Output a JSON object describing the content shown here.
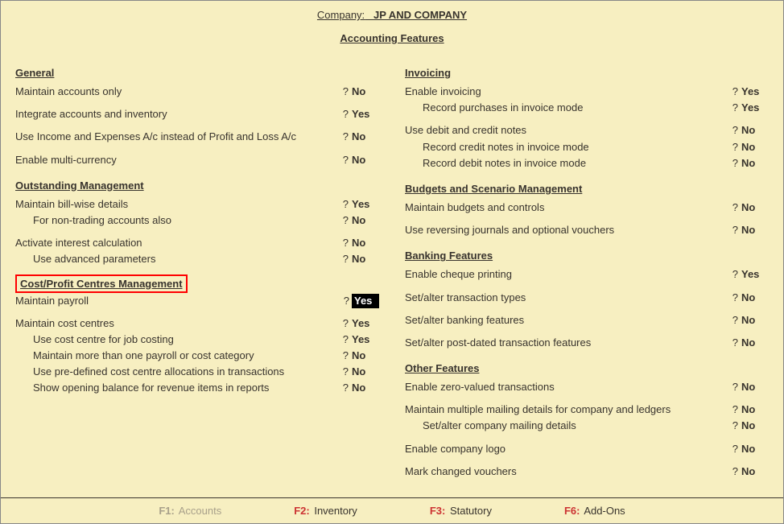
{
  "header": {
    "company_label": "Company:",
    "company_name": "JP AND COMPANY",
    "subtitle": "Accounting Features"
  },
  "left": {
    "general": {
      "title": "General",
      "r1": {
        "label": "Maintain accounts only",
        "value": "No"
      },
      "r2": {
        "label": "Integrate accounts and inventory",
        "value": "Yes"
      },
      "r3": {
        "label": "Use Income and Expenses A/c instead of Profit and Loss A/c",
        "value": "No"
      },
      "r4": {
        "label": "Enable multi-currency",
        "value": "No"
      }
    },
    "outstanding": {
      "title": "Outstanding Management",
      "r1": {
        "label": "Maintain bill-wise details",
        "value": "Yes"
      },
      "r1a": {
        "label": "For non-trading accounts also",
        "value": "No"
      },
      "r2": {
        "label": "Activate interest calculation",
        "value": "No"
      },
      "r2a": {
        "label": "Use advanced parameters",
        "value": "No"
      }
    },
    "cost": {
      "title": "Cost/Profit Centres Management",
      "r1": {
        "label": "Maintain payroll",
        "value": "Yes"
      },
      "r2": {
        "label": "Maintain cost centres",
        "value": "Yes"
      },
      "r2a": {
        "label": "Use cost centre for job costing",
        "value": "Yes"
      },
      "r2b": {
        "label": "Maintain more than one payroll or cost category",
        "value": "No"
      },
      "r2c": {
        "label": "Use pre-defined cost centre allocations in transactions",
        "value": "No"
      },
      "r2d": {
        "label": "Show opening balance for revenue items in reports",
        "value": "No"
      }
    }
  },
  "right": {
    "invoicing": {
      "title": "Invoicing",
      "r1": {
        "label": "Enable invoicing",
        "value": "Yes"
      },
      "r1a": {
        "label": "Record purchases in invoice mode",
        "value": "Yes"
      },
      "r2": {
        "label": "Use debit and credit notes",
        "value": "No"
      },
      "r2a": {
        "label": "Record credit notes in invoice mode",
        "value": "No"
      },
      "r2b": {
        "label": "Record debit notes in invoice mode",
        "value": "No"
      }
    },
    "budgets": {
      "title": "Budgets and Scenario Management",
      "r1": {
        "label": "Maintain budgets and controls",
        "value": "No"
      },
      "r2": {
        "label": "Use reversing journals and optional vouchers",
        "value": "No"
      }
    },
    "banking": {
      "title": "Banking Features",
      "r1": {
        "label": "Enable cheque printing",
        "value": "Yes"
      },
      "r2": {
        "label": "Set/alter transaction types",
        "value": "No"
      },
      "r3": {
        "label": "Set/alter banking features",
        "value": "No"
      },
      "r4": {
        "label": "Set/alter post-dated transaction features",
        "value": "No"
      }
    },
    "other": {
      "title": "Other Features",
      "r1": {
        "label": "Enable zero-valued transactions",
        "value": "No"
      },
      "r2": {
        "label": "Maintain multiple mailing details for company and ledgers",
        "value": "No"
      },
      "r2a": {
        "label": "Set/alter company mailing details",
        "value": "No"
      },
      "r3": {
        "label": "Enable company logo",
        "value": "No"
      },
      "r4": {
        "label": "Mark changed vouchers",
        "value": "No"
      }
    }
  },
  "footer": {
    "f1": {
      "key": "F1:",
      "label": "Accounts"
    },
    "f2": {
      "key": "F2:",
      "label": "Inventory"
    },
    "f3": {
      "key": "F3:",
      "label": "Statutory"
    },
    "f6": {
      "key": "F6:",
      "label": "Add-Ons"
    }
  }
}
